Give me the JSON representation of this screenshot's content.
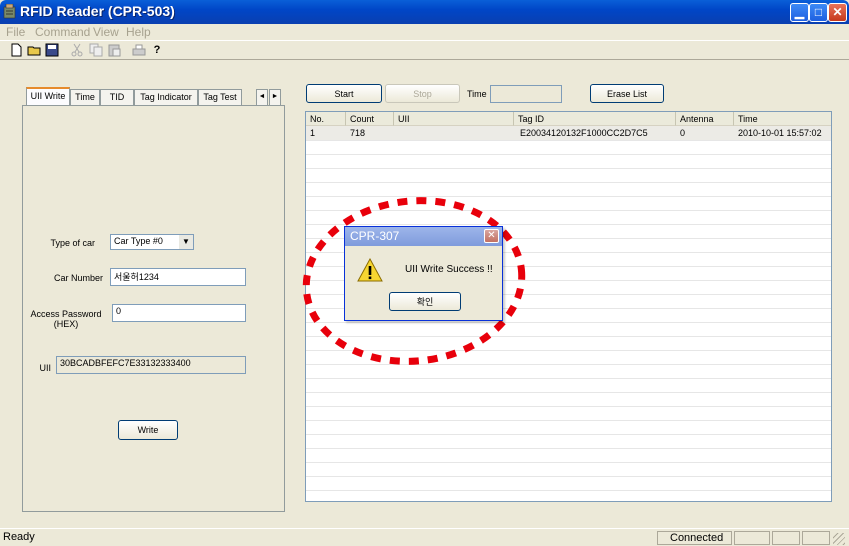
{
  "window": {
    "title": "RFID Reader (CPR-503)"
  },
  "menu": {
    "items": [
      "File",
      "Command",
      "View",
      "Help"
    ]
  },
  "toolbar": {
    "icons": [
      "new-icon",
      "open-icon",
      "save-icon",
      "cut-icon",
      "copy-icon",
      "paste-icon",
      "print-icon",
      "help-icon"
    ]
  },
  "tabs": {
    "items": [
      "UII Write",
      "Time",
      "TID",
      "Tag Indicator",
      "Tag Test"
    ],
    "scroll_left": "◄",
    "scroll_right": "►"
  },
  "form": {
    "type_label": "Type of car",
    "type_value": "Car Type #0",
    "car_number_label": "Car Number",
    "car_number_value": "서울허1234",
    "access_password_label": "Access Password\n(HEX)",
    "access_password_value": "0",
    "uii_label": "UII",
    "uii_value": "30BCADBFEFC7E33132333400",
    "write_label": "Write"
  },
  "controls": {
    "start_label": "Start",
    "stop_label": "Stop",
    "time_label": "Time",
    "time_value": "",
    "erase_label": "Erase List"
  },
  "list": {
    "columns": [
      "No.",
      "Count",
      "UII",
      "Tag ID",
      "Antenna",
      "Time"
    ],
    "rows": [
      {
        "no": "1",
        "count": "718",
        "uii": "",
        "tag_id": "E20034120132F1000CC2D7C5",
        "antenna": "0",
        "time": "2010-10-01 15:57:02"
      }
    ]
  },
  "dialog": {
    "title": "CPR-307",
    "message": "UII Write Success !!",
    "ok_label": "확인"
  },
  "status": {
    "text": "Ready",
    "connection": "Connected"
  },
  "colors": {
    "highlight_ring": "#e8000b",
    "titlebar": "#0046c7"
  }
}
